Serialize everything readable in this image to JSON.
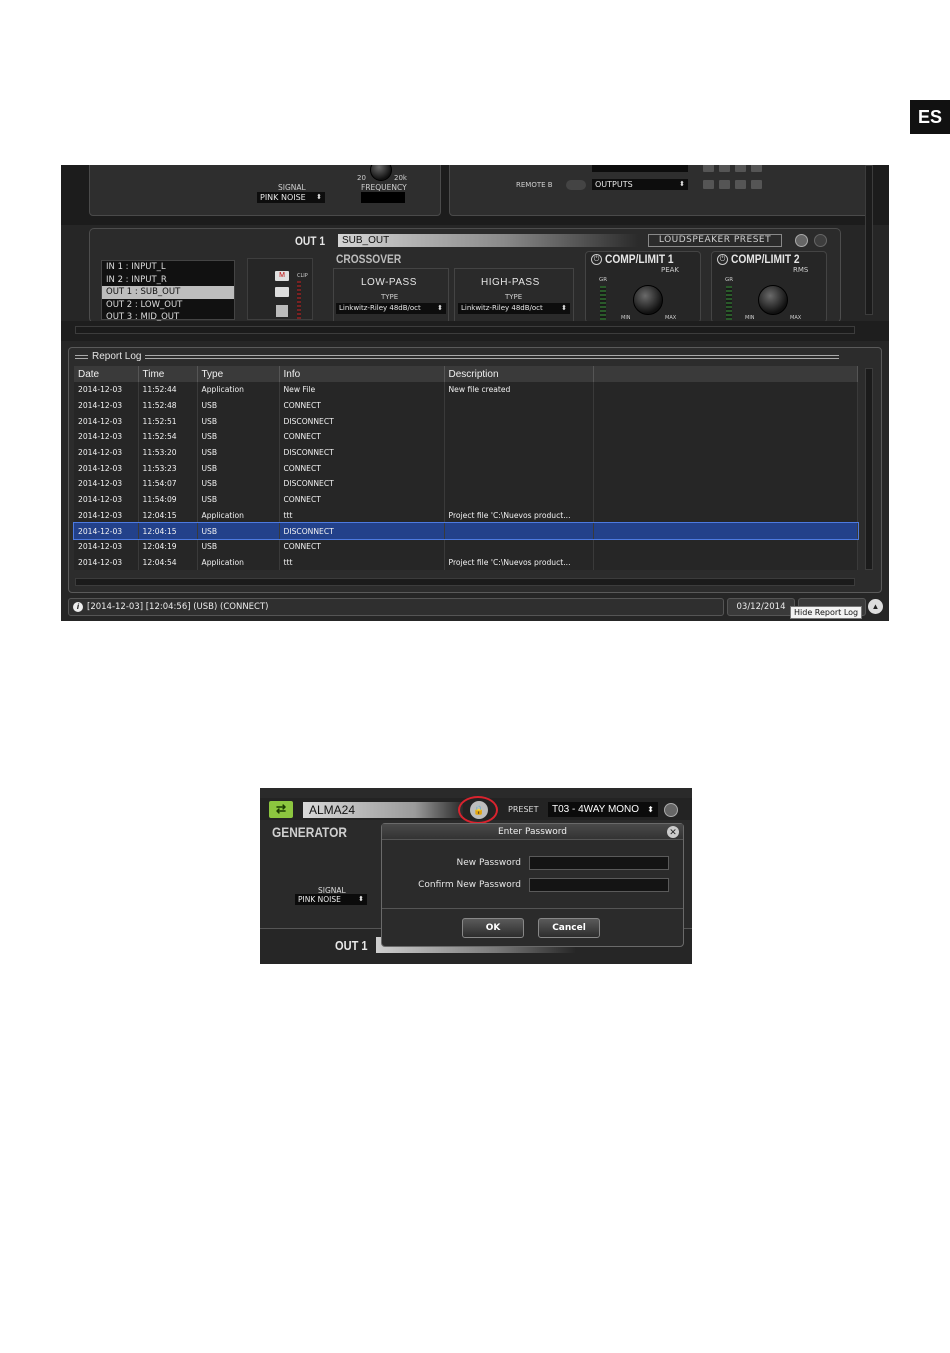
{
  "lang_tab": "ES",
  "shot1": {
    "top": {
      "signal_label": "SIGNAL",
      "signal_value": "PINK NOISE",
      "frequency_label": "FREQUENCY",
      "freq_scale_a": "20",
      "freq_scale_b": "20k",
      "remote_b_label": "REMOTE B",
      "remote_b_value": "OUTPUTS"
    },
    "out": {
      "label": "OUT 1",
      "name": "SUB_OUT",
      "preset_button": "LOUDSPEAKER PRESET",
      "crossover_title": "CROSSOVER",
      "low_pass": "LOW-PASS",
      "high_pass": "HIGH-PASS",
      "type_label": "TYPE",
      "low_pass_type": "Linkwitz-Riley 48dB/oct",
      "high_pass_type": "Linkwitz-Riley 48dB/oct",
      "comp1_title": "COMP/LIMIT 1",
      "comp1_mode": "PEAK",
      "comp2_title": "COMP/LIMIT 2",
      "comp2_mode": "RMS",
      "gr_label": "GR",
      "min_label": "MIN",
      "max_label": "MAX",
      "m_button": "M",
      "clip_label": "CLIP",
      "channels": [
        "IN 1 : INPUT_L",
        "IN 2 : INPUT_R",
        "OUT 1 : SUB_OUT",
        "OUT 2 : LOW_OUT",
        "OUT 3 : MID_OUT"
      ],
      "active_channel_index": 2
    },
    "report_log": {
      "title": "Report Log",
      "columns": [
        "Date",
        "Time",
        "Type",
        "Info",
        "Description"
      ],
      "rows": [
        [
          "2014-12-03",
          "11:52:44",
          "Application",
          "New File",
          "New file created"
        ],
        [
          "2014-12-03",
          "11:52:48",
          "USB",
          "CONNECT",
          ""
        ],
        [
          "2014-12-03",
          "11:52:51",
          "USB",
          "DISCONNECT",
          ""
        ],
        [
          "2014-12-03",
          "11:52:54",
          "USB",
          "CONNECT",
          ""
        ],
        [
          "2014-12-03",
          "11:53:20",
          "USB",
          "DISCONNECT",
          ""
        ],
        [
          "2014-12-03",
          "11:53:23",
          "USB",
          "CONNECT",
          ""
        ],
        [
          "2014-12-03",
          "11:54:07",
          "USB",
          "DISCONNECT",
          ""
        ],
        [
          "2014-12-03",
          "11:54:09",
          "USB",
          "CONNECT",
          ""
        ],
        [
          "2014-12-03",
          "12:04:15",
          "Application",
          "ttt",
          "Project file 'C:\\Nuevos product..."
        ],
        [
          "2014-12-03",
          "12:04:15",
          "USB",
          "DISCONNECT",
          ""
        ],
        [
          "2014-12-03",
          "12:04:19",
          "USB",
          "CONNECT",
          ""
        ],
        [
          "2014-12-03",
          "12:04:54",
          "Application",
          "ttt",
          "Project file 'C:\\Nuevos product..."
        ]
      ],
      "selected_row_index": 9
    },
    "status_bar": {
      "message": "[2014-12-03] [12:04:56] (USB) (CONNECT)",
      "date": "03/12/2014",
      "tooltip": "Hide Report Log"
    }
  },
  "shot2": {
    "device_name": "ALMA24",
    "preset_label": "PRESET",
    "preset_value": "T03 - 4WAY MONO",
    "generator_title": "GENERATOR",
    "signal_label": "SIGNAL",
    "signal_value": "PINK NOISE",
    "out_label": "OUT 1",
    "dialog": {
      "title": "Enter Password",
      "new_password_label": "New Password",
      "confirm_label": "Confirm New Password",
      "ok": "OK",
      "cancel": "Cancel"
    },
    "highlight_color": "#d9232e"
  }
}
